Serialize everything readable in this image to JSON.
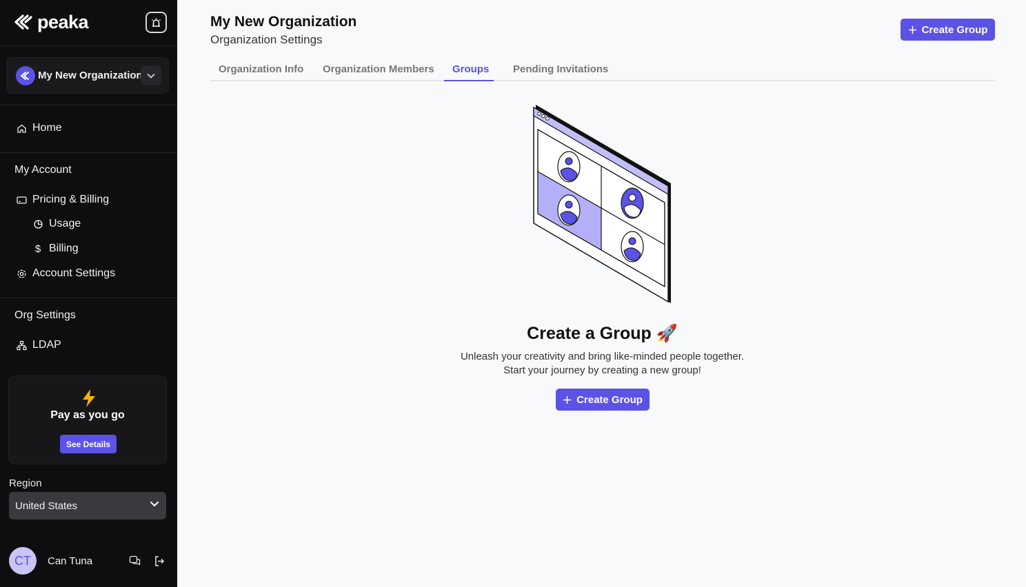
{
  "app": {
    "brand": "peaka"
  },
  "sidebar": {
    "org_switcher": {
      "name": "My New Organization"
    },
    "home_label": "Home",
    "my_account_heading": "My Account",
    "items": [
      {
        "label": "Pricing & Billing",
        "icon": "credit-card-icon"
      },
      {
        "label": "Usage",
        "icon": "pie-chart-icon"
      },
      {
        "label": "Billing",
        "icon": "dollar-icon"
      },
      {
        "label": "Account Settings",
        "icon": "gear-icon"
      }
    ],
    "org_settings_heading": "Org Settings",
    "ldap_label": "LDAP",
    "plan": {
      "title": "Pay as you go",
      "button": "See Details"
    },
    "region": {
      "label": "Region",
      "value": "United States"
    },
    "user": {
      "initials": "CT",
      "name": "Can Tuna"
    }
  },
  "header": {
    "title": "My New Organization",
    "subtitle": "Organization Settings",
    "create_button": "Create Group"
  },
  "tabs": [
    {
      "label": "Organization Info",
      "active": false
    },
    {
      "label": "Organization Members",
      "active": false
    },
    {
      "label": "Groups",
      "active": true
    },
    {
      "label": "Pending Invitations",
      "active": false
    }
  ],
  "empty_state": {
    "title": "Create a Group 🚀",
    "line1": "Unleash your creativity and bring like-minded people together.",
    "line2": "Start your journey by creating a new group!",
    "button": "Create Group"
  },
  "colors": {
    "accent": "#5b52e6",
    "sidebar_bg": "#0e0e10",
    "main_bg": "#f8f9fb"
  }
}
